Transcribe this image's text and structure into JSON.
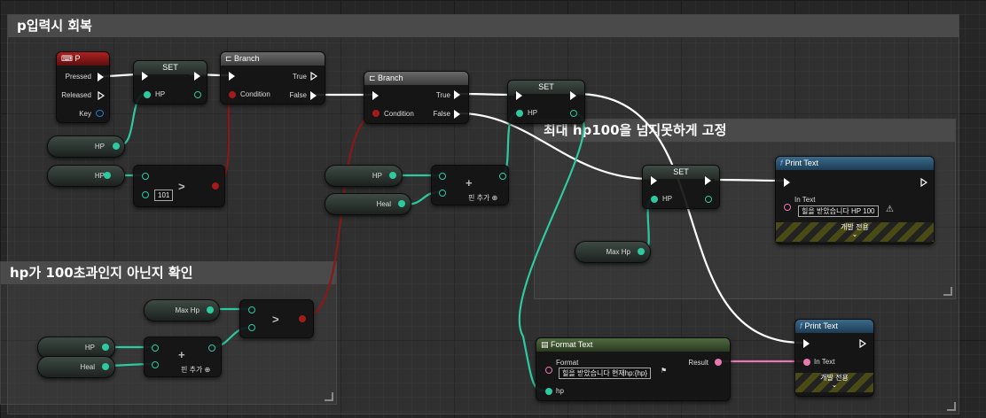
{
  "comments": {
    "main": "p입력시 회복",
    "hp_check": "hp가 100초과인지 아닌지 확인",
    "hp_fix": "최대 hp100을 넘지못하게 고정"
  },
  "key_node": {
    "title": "P",
    "pressed": "Pressed",
    "released": "Released",
    "key": "Key"
  },
  "set1": {
    "title": "SET",
    "pin": "HP"
  },
  "set2": {
    "title": "SET",
    "pin": "HP"
  },
  "set3": {
    "title": "SET",
    "pin": "HP"
  },
  "branch1": {
    "title": "Branch",
    "true": "True",
    "false": "False",
    "condition": "Condition"
  },
  "branch2": {
    "title": "Branch",
    "true": "True",
    "false": "False",
    "condition": "Condition"
  },
  "vars": {
    "hp": "HP",
    "heal": "Heal",
    "maxhp": "Max Hp"
  },
  "compare1": {
    "op": ">",
    "value": "101"
  },
  "compare2": {
    "op": ">"
  },
  "add": {
    "op": "+",
    "add_pin": "핀 추가"
  },
  "print1": {
    "title": "Print Text",
    "in_text": "In Text",
    "value": "힐을 받았습니다 HP 100",
    "dev_only": "개발 전용"
  },
  "print2": {
    "title": "Print Text",
    "in_text": "In Text",
    "dev_only": "개발 전용"
  },
  "format": {
    "title": "Format Text",
    "format_label": "Format",
    "format_value": "힐을 받았습니다 현재hp:{hp}",
    "result": "Result",
    "hp": "hp"
  },
  "colors": {
    "exec": "#ffffff",
    "float": "#2ec9a0",
    "bool": "#a41b1b",
    "text": "#e879b0",
    "key": "#2a74d8"
  }
}
